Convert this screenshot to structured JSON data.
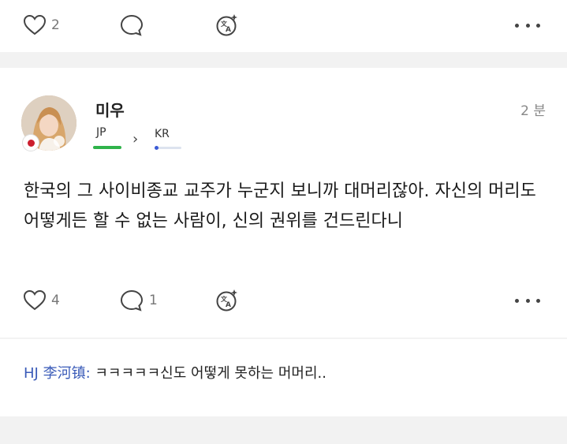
{
  "top_bar": {
    "like_count": "2"
  },
  "post": {
    "username": "미우",
    "time": "2 분",
    "lang_from": "JP",
    "lang_to": "KR",
    "body": "한국의 그 사이비종교 교주가 누군지 보니까 대머리잖아. 자신의 머리도 어떻게든 할 수 없는 사람이, 신의 권위를 건드린다니",
    "like_count": "4",
    "comment_count": "1"
  },
  "reply": {
    "author": "HJ 李河镇:",
    "text": "ㅋㅋㅋㅋㅋ신도 어떻게 못하는 머머리.."
  },
  "colors": {
    "accent_green": "#2fb34a",
    "reply_author": "#3a5bb8",
    "flag_red": "#cc1f2f"
  },
  "icons": [
    "heart-icon",
    "comment-icon",
    "translate-icon",
    "more-icon"
  ]
}
